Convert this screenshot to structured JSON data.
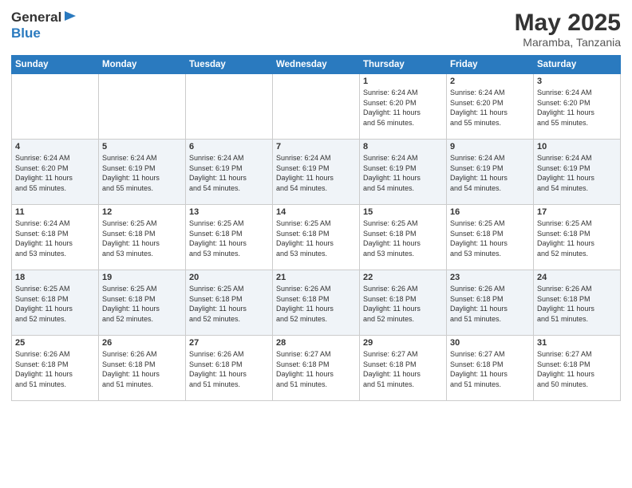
{
  "header": {
    "logo_general": "General",
    "logo_blue": "Blue",
    "month_title": "May 2025",
    "location": "Maramba, Tanzania"
  },
  "weekdays": [
    "Sunday",
    "Monday",
    "Tuesday",
    "Wednesday",
    "Thursday",
    "Friday",
    "Saturday"
  ],
  "weeks": [
    [
      {
        "day": "",
        "info": ""
      },
      {
        "day": "",
        "info": ""
      },
      {
        "day": "",
        "info": ""
      },
      {
        "day": "",
        "info": ""
      },
      {
        "day": "1",
        "info": "Sunrise: 6:24 AM\nSunset: 6:20 PM\nDaylight: 11 hours\nand 56 minutes."
      },
      {
        "day": "2",
        "info": "Sunrise: 6:24 AM\nSunset: 6:20 PM\nDaylight: 11 hours\nand 55 minutes."
      },
      {
        "day": "3",
        "info": "Sunrise: 6:24 AM\nSunset: 6:20 PM\nDaylight: 11 hours\nand 55 minutes."
      }
    ],
    [
      {
        "day": "4",
        "info": "Sunrise: 6:24 AM\nSunset: 6:20 PM\nDaylight: 11 hours\nand 55 minutes."
      },
      {
        "day": "5",
        "info": "Sunrise: 6:24 AM\nSunset: 6:19 PM\nDaylight: 11 hours\nand 55 minutes."
      },
      {
        "day": "6",
        "info": "Sunrise: 6:24 AM\nSunset: 6:19 PM\nDaylight: 11 hours\nand 54 minutes."
      },
      {
        "day": "7",
        "info": "Sunrise: 6:24 AM\nSunset: 6:19 PM\nDaylight: 11 hours\nand 54 minutes."
      },
      {
        "day": "8",
        "info": "Sunrise: 6:24 AM\nSunset: 6:19 PM\nDaylight: 11 hours\nand 54 minutes."
      },
      {
        "day": "9",
        "info": "Sunrise: 6:24 AM\nSunset: 6:19 PM\nDaylight: 11 hours\nand 54 minutes."
      },
      {
        "day": "10",
        "info": "Sunrise: 6:24 AM\nSunset: 6:19 PM\nDaylight: 11 hours\nand 54 minutes."
      }
    ],
    [
      {
        "day": "11",
        "info": "Sunrise: 6:24 AM\nSunset: 6:18 PM\nDaylight: 11 hours\nand 53 minutes."
      },
      {
        "day": "12",
        "info": "Sunrise: 6:25 AM\nSunset: 6:18 PM\nDaylight: 11 hours\nand 53 minutes."
      },
      {
        "day": "13",
        "info": "Sunrise: 6:25 AM\nSunset: 6:18 PM\nDaylight: 11 hours\nand 53 minutes."
      },
      {
        "day": "14",
        "info": "Sunrise: 6:25 AM\nSunset: 6:18 PM\nDaylight: 11 hours\nand 53 minutes."
      },
      {
        "day": "15",
        "info": "Sunrise: 6:25 AM\nSunset: 6:18 PM\nDaylight: 11 hours\nand 53 minutes."
      },
      {
        "day": "16",
        "info": "Sunrise: 6:25 AM\nSunset: 6:18 PM\nDaylight: 11 hours\nand 53 minutes."
      },
      {
        "day": "17",
        "info": "Sunrise: 6:25 AM\nSunset: 6:18 PM\nDaylight: 11 hours\nand 52 minutes."
      }
    ],
    [
      {
        "day": "18",
        "info": "Sunrise: 6:25 AM\nSunset: 6:18 PM\nDaylight: 11 hours\nand 52 minutes."
      },
      {
        "day": "19",
        "info": "Sunrise: 6:25 AM\nSunset: 6:18 PM\nDaylight: 11 hours\nand 52 minutes."
      },
      {
        "day": "20",
        "info": "Sunrise: 6:25 AM\nSunset: 6:18 PM\nDaylight: 11 hours\nand 52 minutes."
      },
      {
        "day": "21",
        "info": "Sunrise: 6:26 AM\nSunset: 6:18 PM\nDaylight: 11 hours\nand 52 minutes."
      },
      {
        "day": "22",
        "info": "Sunrise: 6:26 AM\nSunset: 6:18 PM\nDaylight: 11 hours\nand 52 minutes."
      },
      {
        "day": "23",
        "info": "Sunrise: 6:26 AM\nSunset: 6:18 PM\nDaylight: 11 hours\nand 51 minutes."
      },
      {
        "day": "24",
        "info": "Sunrise: 6:26 AM\nSunset: 6:18 PM\nDaylight: 11 hours\nand 51 minutes."
      }
    ],
    [
      {
        "day": "25",
        "info": "Sunrise: 6:26 AM\nSunset: 6:18 PM\nDaylight: 11 hours\nand 51 minutes."
      },
      {
        "day": "26",
        "info": "Sunrise: 6:26 AM\nSunset: 6:18 PM\nDaylight: 11 hours\nand 51 minutes."
      },
      {
        "day": "27",
        "info": "Sunrise: 6:26 AM\nSunset: 6:18 PM\nDaylight: 11 hours\nand 51 minutes."
      },
      {
        "day": "28",
        "info": "Sunrise: 6:27 AM\nSunset: 6:18 PM\nDaylight: 11 hours\nand 51 minutes."
      },
      {
        "day": "29",
        "info": "Sunrise: 6:27 AM\nSunset: 6:18 PM\nDaylight: 11 hours\nand 51 minutes."
      },
      {
        "day": "30",
        "info": "Sunrise: 6:27 AM\nSunset: 6:18 PM\nDaylight: 11 hours\nand 51 minutes."
      },
      {
        "day": "31",
        "info": "Sunrise: 6:27 AM\nSunset: 6:18 PM\nDaylight: 11 hours\nand 50 minutes."
      }
    ]
  ]
}
